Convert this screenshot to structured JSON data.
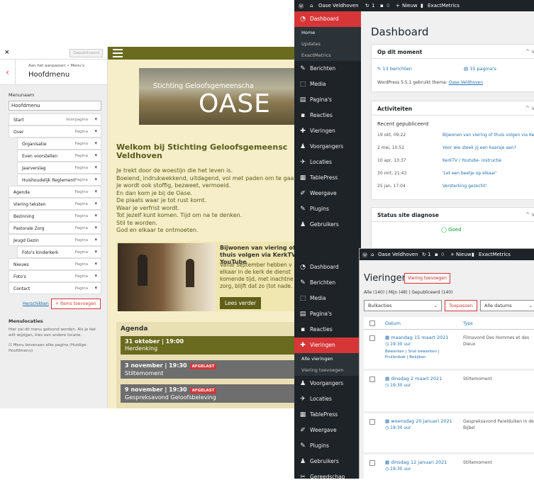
{
  "customizer": {
    "close": "×",
    "publish": "Gepubliceerd",
    "back": "‹",
    "subtitle": "Aan het aanpassen • Menu's",
    "title": "Hoofdmenu",
    "menuname_label": "Menunaam",
    "menuname_value": "Hoofdmenu",
    "items": [
      {
        "label": "Start",
        "kind": "Voorpagina",
        "indent": false
      },
      {
        "label": "Over",
        "kind": "Pagina",
        "indent": false
      },
      {
        "label": "Organisatie",
        "kind": "Pagina",
        "indent": true
      },
      {
        "label": "Even voorstellen",
        "kind": "Pagina",
        "indent": true
      },
      {
        "label": "Jaarverslag",
        "kind": "Pagina",
        "indent": true
      },
      {
        "label": "Huishoudelijk Reglement",
        "kind": "Pagina",
        "indent": true
      },
      {
        "label": "Agenda",
        "kind": "Pagina",
        "indent": false
      },
      {
        "label": "Viering teksten",
        "kind": "Pagina",
        "indent": false
      },
      {
        "label": "Bezinning",
        "kind": "Pagina",
        "indent": false
      },
      {
        "label": "Pastorale Zorg",
        "kind": "Pagina",
        "indent": false
      },
      {
        "label": "Jeugd Gezin",
        "kind": "Pagina",
        "indent": false
      },
      {
        "label": "Foto's kinderkerk",
        "kind": "Pagina",
        "indent": true
      },
      {
        "label": "Nieuws",
        "kind": "Pagina",
        "indent": false
      },
      {
        "label": "Foto's",
        "kind": "Pagina",
        "indent": false
      },
      {
        "label": "Contact",
        "kind": "Pagina",
        "indent": false
      }
    ],
    "reorder": "Herschikken",
    "add_items": "Items toevoegen",
    "locations_title": "Menulocaties",
    "locations_desc": "Hier zal dit menu getoond worden. Als je dat wilt wijzigen, kies een andere locatie.",
    "checkbox_label": "Menu bovenaan elke pagina (Huidige: Hoofdmenu)"
  },
  "preview": {
    "banner_small": "Stichting Geloofsgemeenscha",
    "banner_big": "OASE",
    "welcome": "Welkom bij Stichting Geloofsgemeensc Veldhoven",
    "poem": [
      "Je trekt door de woestijn die het leven is.",
      "Boeiend, indrukwekkend, uitdagend, vol met paden om te gaan",
      "Je wordt ook stoffig, bezweet, vermoeid.",
      "En dan kom je bij de Oase.",
      "De plaats waar je tot rust komt.",
      "Waar je verfrist wordt.",
      "Tot jezelf kunt komen. Tijd om na te denken.",
      "Stil te worden.",
      "God en elkaar te ontmoeten."
    ],
    "news_title": "Bijwonen van viering of thuis volgen via KerkTV of YouTube",
    "news_text": "Vanaf september hebben v elkaar in de kerk de dienst komende tijd, met inachtne zorg, blijft dat zo (tot nade.",
    "read_more": "Lees verder",
    "agenda_title": "Agenda",
    "events": [
      {
        "date": "31 oktober | 19:00",
        "name": "Herdenking",
        "tag": "",
        "color": "#6b6b1f"
      },
      {
        "date": "3 november | 19:30",
        "name": "Stiltemoment",
        "tag": "AFGELAST",
        "color": "#6e6e6e"
      },
      {
        "date": "9 november | 19:30",
        "name": "Gespreksavond Geloofsbeleving",
        "tag": "AFGELAST",
        "color": "#6e6e6e"
      }
    ]
  },
  "dashboard": {
    "site": "Oase Veldhoven",
    "updates_count": "1",
    "comments": "0",
    "new": "Nieuw",
    "metrics": "ExactMetrics",
    "menu": [
      "Dashboard",
      "Berichten",
      "Media",
      "Pagina's",
      "Reacties",
      "Vieringen",
      "Voorgangers",
      "Locaties",
      "TablePress",
      "Weergave",
      "Plugins",
      "Gebruikers"
    ],
    "submenu": [
      "Home",
      "Updates",
      "ExactMetrics"
    ],
    "title": "Dashboard",
    "glance_title": "Op dit moment",
    "posts": "13 berichten",
    "pages": "31 pagina's",
    "wp_version": "WordPress 5.5.1 gebruikt thema:",
    "theme": "Oase Veldhoven",
    "activity_title": "Activiteiten",
    "recent": "Recent gepubliceerd",
    "activity": [
      {
        "date": "19 okt, 09:22",
        "title": "Bijwonen van viering of thuis volgen via KerkTV of YouTube"
      },
      {
        "date": "2 mei, 10:52",
        "title": "Voor wie steek jij een kaarsje aan?"
      },
      {
        "date": "10 apr, 13:37",
        "title": "KerkTV / Youtube- instructie"
      },
      {
        "date": "30 mrt, 21:43",
        "title": "'Let een beetje op elkaar'"
      },
      {
        "date": "25 jan, 17:04",
        "title": "Versterking gezocht!"
      }
    ],
    "health_title": "Status site diagnose",
    "health_status": "Goed"
  },
  "vieringen": {
    "title": "Vieringen",
    "add_new": "Viering toevoegen",
    "filters": "Alle (140) | Mijn (48) | Gepubliceerd (140)",
    "bulk": "Bulkacties",
    "apply": "Toepassen",
    "all_dates": "Alle datums",
    "col_date": "Datum",
    "col_type": "Type",
    "menu": [
      "Dashboard",
      "Berichten",
      "Media",
      "Pagina's",
      "Reacties",
      "Vieringen",
      "Voorgangers",
      "Locaties",
      "TablePress",
      "Weergave",
      "Plugins",
      "Gebruikers",
      "Gereedschap"
    ],
    "submenu": [
      "Alle vieringen",
      "Viering toevoegen"
    ],
    "rows": [
      {
        "date": "maandag 15 maart 2021",
        "time": "19:30 uur",
        "type": "Filmavond Des Hommes et des Dieux",
        "actions": "Bewerken | Snel bewerken | Prullenbak | Bekijken"
      },
      {
        "date": "dinsdag 2 maart 2021",
        "time": "19:30 uur",
        "type": "Stiltemoment",
        "actions": ""
      },
      {
        "date": "woensdag 20 januari 2021",
        "time": "19:30 uur",
        "type": "Gespreksavond Parelduiken in de Bijbel",
        "actions": ""
      },
      {
        "date": "dinsdag 12 januari 2021",
        "time": "19:30 uur",
        "type": "Stiltemoment",
        "actions": ""
      }
    ]
  }
}
